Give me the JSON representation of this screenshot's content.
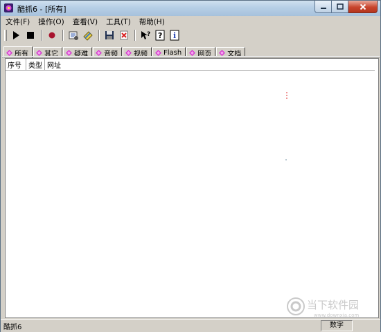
{
  "window": {
    "title": "酷抓6 - [所有]"
  },
  "menu": [
    "文件(F)",
    "操作(O)",
    "查看(V)",
    "工具(T)",
    "帮助(H)"
  ],
  "toolbar": {
    "buttons": [
      {
        "name": "play",
        "icon": "play-icon"
      },
      {
        "name": "stop",
        "icon": "stop-icon"
      },
      {
        "name": "record",
        "icon": "record-icon"
      },
      {
        "name": "options",
        "icon": "options-icon"
      },
      {
        "name": "clean",
        "icon": "clean-icon"
      },
      {
        "name": "save",
        "icon": "floppy-icon"
      },
      {
        "name": "delete",
        "icon": "delete-icon"
      },
      {
        "name": "context-help",
        "icon": "help-pointer-icon"
      },
      {
        "name": "help",
        "icon": "question-icon"
      },
      {
        "name": "about",
        "icon": "info-icon"
      }
    ]
  },
  "tabs": [
    "所有",
    "其它",
    "疑难",
    "音频",
    "视频",
    "Flash",
    "网页",
    "文档"
  ],
  "active_tab": "所有",
  "list": {
    "columns": [
      "序号",
      "类型",
      "网址"
    ],
    "rows": []
  },
  "status": {
    "left": "酷抓6",
    "right": "数字"
  },
  "watermark": {
    "text": "当下软件园",
    "sub": "www.downxia.com"
  },
  "colors": {
    "tab_gem": "#d63fd0",
    "titlebar": "#b7cfe6",
    "close": "#c8452d"
  }
}
